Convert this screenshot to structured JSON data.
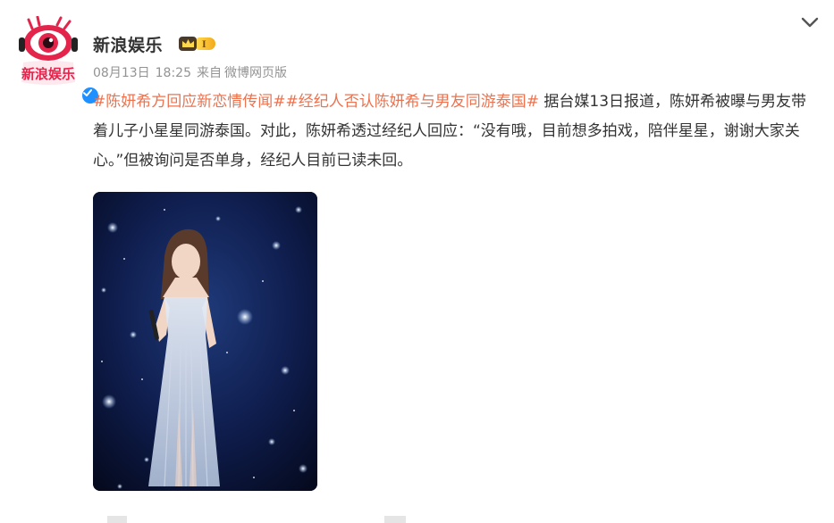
{
  "post": {
    "author": {
      "name": "新浪娱乐",
      "avatar_text": "新浪娱乐",
      "vip_level": "I",
      "verified": true
    },
    "meta": {
      "date": "08月13日",
      "time": "18:25",
      "source_prefix": "来自",
      "source": "微博网页版"
    },
    "text": {
      "topic1": "#陈妍希方回应新恋情传闻#",
      "topic2": "#经纪人否认陈妍希与男友同游泰国#",
      "content": " 据台媒13日报道，陈妍希被曝与男友带着儿子小星星同游泰国。对此，陈妍希透过经纪人回应：“没有哦，目前想多拍戏，陪伴星星，谢谢大家关心。”但被询问是否单身，经纪人目前已读未回。"
    },
    "image": {
      "description_icon": "concert-photo"
    }
  },
  "colors": {
    "topic": "#eb7350",
    "meta": "#939393",
    "text": "#333333",
    "vip_gold": "#f3a91c",
    "verified_blue": "#1e90ff"
  },
  "icons": {
    "menu": "chevron-down-icon",
    "verified": "verified-check-icon",
    "vip": "crown-icon"
  }
}
